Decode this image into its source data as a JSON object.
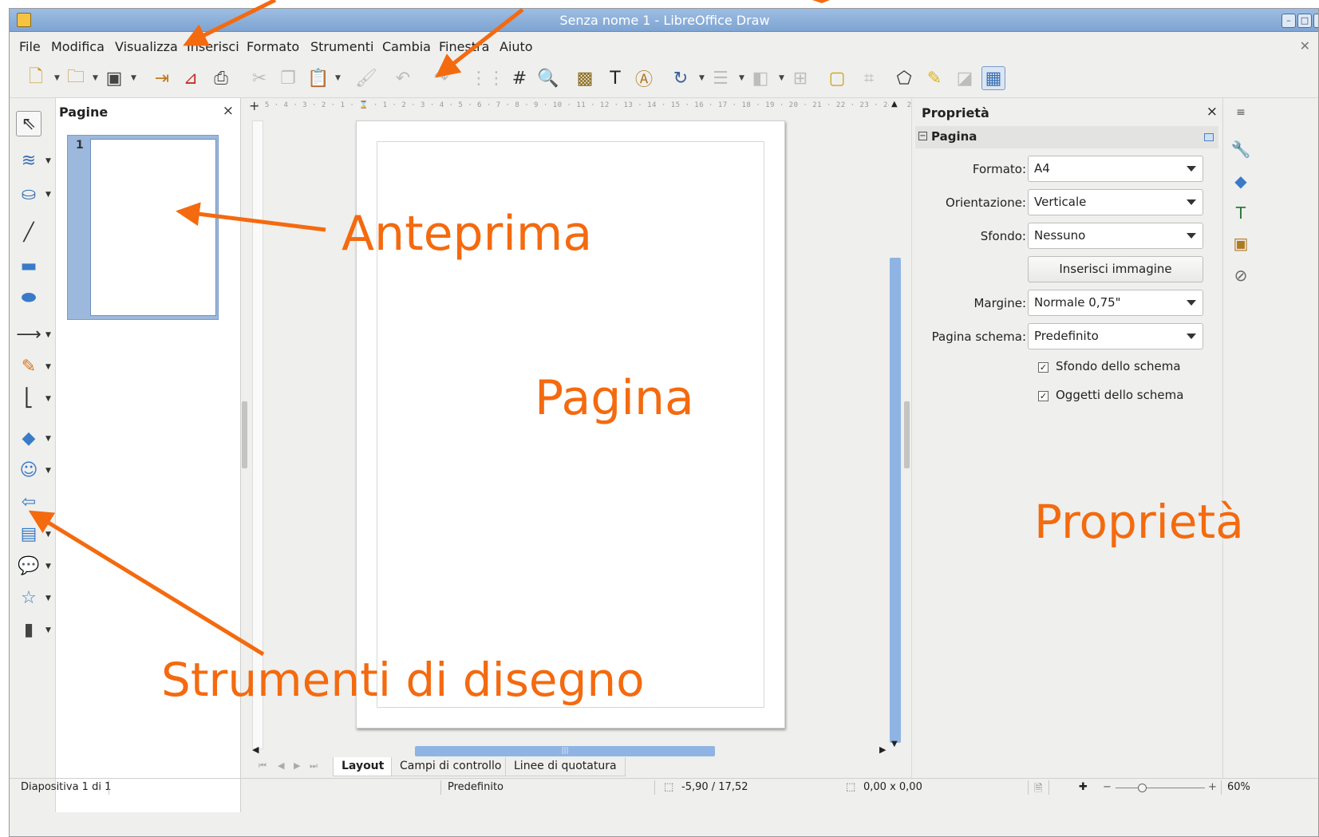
{
  "window": {
    "title": "Senza nome 1 - LibreOffice Draw"
  },
  "menu": [
    "File",
    "Modifica",
    "Visualizza",
    "Inserisci",
    "Formato",
    "Strumenti",
    "Cambia",
    "Finestra",
    "Aiuto"
  ],
  "toolbar": {
    "icons": [
      "new-document-icon",
      "open-folder-icon",
      "save-icon",
      "export-icon",
      "export-pdf-icon",
      "print-icon",
      "cut-icon",
      "copy-icon",
      "paste-icon",
      "clone-formatting-icon",
      "undo-icon",
      "redo-icon",
      "grid-icon",
      "helplines-icon",
      "zoom-pan-icon",
      "insert-image-icon",
      "insert-textbox-icon",
      "fontwork-icon",
      "rotate-icon",
      "align-icon",
      "arrange-icon",
      "distribute-icon",
      "shadow-icon",
      "crop-icon",
      "points-icon",
      "glue-points-icon",
      "extrusion-icon",
      "toggle-sidebar-icon"
    ]
  },
  "pages_panel": {
    "title": "Pagine",
    "close": "×",
    "thumbnail_number": "1"
  },
  "ruler": {
    "horizontal_text": "· 5 · 4 · 3 · 2 · 1 · ⌛ · 1 · 2 · 3 · 4 · 5 · 6 · 7 · 8 · 9 · 10 · 11 · 12 · 13 · 14 · 15 · 16 · 17 · 18 · 19 · 20 · 21 · 22 · 23 · 24 · 2"
  },
  "tabs": [
    "Layout",
    "Campi di controllo",
    "Linee di quotatura"
  ],
  "properties": {
    "title": "Proprietà",
    "close": "×",
    "section": "Pagina",
    "rows": [
      {
        "label": "Formato:",
        "value": "A4"
      },
      {
        "label": "Orientazione:",
        "value": "Verticale"
      },
      {
        "label": "Sfondo:",
        "value": "Nessuno"
      }
    ],
    "insert_image_button": "Inserisci immagine",
    "margin": {
      "label": "Margine:",
      "value": "Normale 0,75\""
    },
    "master_page": {
      "label": "Pagina schema:",
      "value": "Predefinito"
    },
    "checkboxes": [
      {
        "label": "Sfondo dello schema",
        "checked": true
      },
      {
        "label": "Oggetti dello schema",
        "checked": true
      }
    ]
  },
  "statusbar": {
    "slide": "Diapositiva 1 di 1",
    "master": "Predefinito",
    "position": "-5,90 / 17,52",
    "size": "0,00 x 0,00",
    "zoom": "60%"
  },
  "annotations": {
    "preview": "Anteprima",
    "page": "Pagina",
    "properties": "Proprietà",
    "drawing_tools": "Strumenti di disegno"
  },
  "colors": {
    "annotation": "#f46a0f",
    "accent": "#8fb4e3"
  }
}
